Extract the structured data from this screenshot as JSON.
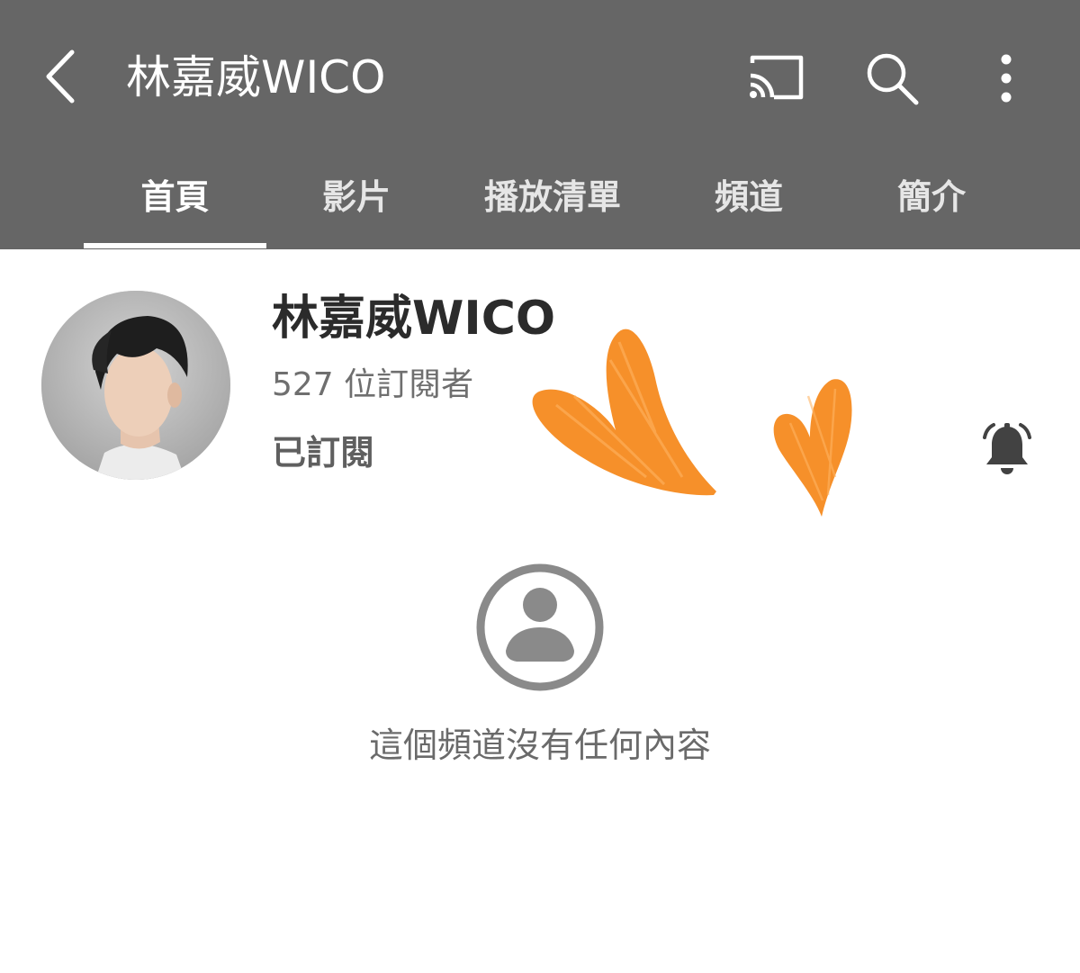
{
  "header": {
    "title": "林嘉威WICO",
    "icons": [
      "back-arrow-icon",
      "cast-icon",
      "search-icon",
      "more-vert-icon"
    ]
  },
  "tabs": [
    {
      "label": "首頁",
      "active": true
    },
    {
      "label": "影片",
      "active": false
    },
    {
      "label": "播放清單",
      "active": false
    },
    {
      "label": "頻道",
      "active": false
    },
    {
      "label": "簡介",
      "active": false
    }
  ],
  "channel": {
    "name": "林嘉威WICO",
    "subscribers": "527 位訂閱者",
    "subscribe_state": "已訂閱",
    "bell_icon": "notification-bell-icon"
  },
  "empty_state": {
    "icon": "account-circle-icon",
    "message": "這個頻道沒有任何內容"
  },
  "colors": {
    "header_bg": "#666666",
    "heart": "#f58a1f",
    "muted_icon": "#8a8a8a"
  }
}
